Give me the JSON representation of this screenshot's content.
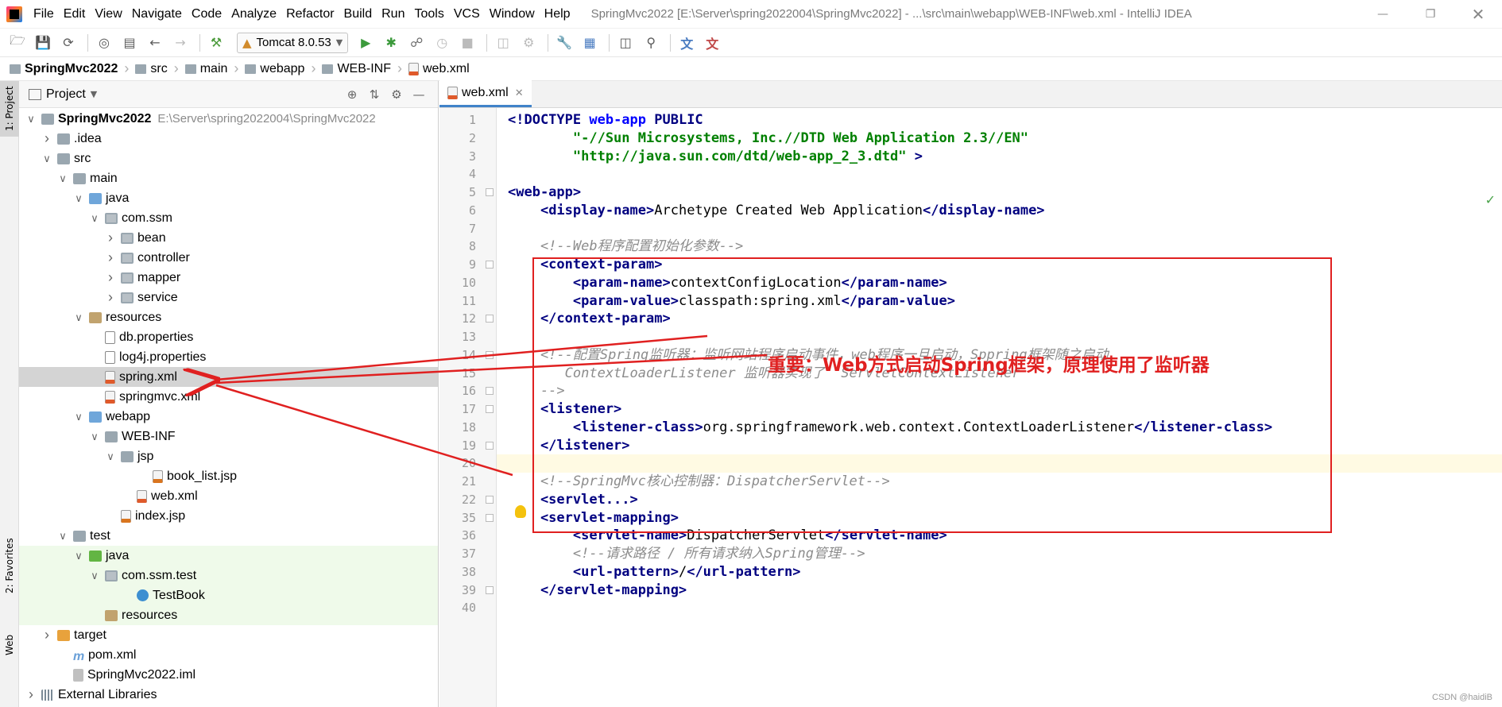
{
  "menubar": {
    "items": [
      "File",
      "Edit",
      "View",
      "Navigate",
      "Code",
      "Analyze",
      "Refactor",
      "Build",
      "Run",
      "Tools",
      "VCS",
      "Window",
      "Help"
    ],
    "title": "SpringMvc2022 [E:\\Server\\spring2022004\\SpringMvc2022] - ...\\src\\main\\webapp\\WEB-INF\\web.xml - IntelliJ IDEA"
  },
  "toolbar": {
    "run_config": "Tomcat 8.0.53"
  },
  "breadcrumb": [
    "SpringMvc2022",
    "src",
    "main",
    "webapp",
    "WEB-INF",
    "web.xml"
  ],
  "left_strip": {
    "project_tab": "1: Project",
    "favorites_tab": "2: Favorites",
    "web_tab": "Web"
  },
  "project_panel": {
    "title": "Project",
    "tree": [
      {
        "label": "SpringMvc2022",
        "hint": "E:\\Server\\spring2022004\\SpringMvc2022",
        "depth": 0,
        "icon": "module",
        "expanded": true,
        "bold": true
      },
      {
        "label": ".idea",
        "depth": 1,
        "icon": "folder",
        "expanded": false
      },
      {
        "label": "src",
        "depth": 1,
        "icon": "folder",
        "expanded": true
      },
      {
        "label": "main",
        "depth": 2,
        "icon": "folder",
        "expanded": true
      },
      {
        "label": "java",
        "depth": 3,
        "icon": "src",
        "expanded": true
      },
      {
        "label": "com.ssm",
        "depth": 4,
        "icon": "pkg",
        "expanded": true
      },
      {
        "label": "bean",
        "depth": 5,
        "icon": "pkg",
        "expanded": false
      },
      {
        "label": "controller",
        "depth": 5,
        "icon": "pkg",
        "expanded": false
      },
      {
        "label": "mapper",
        "depth": 5,
        "icon": "pkg",
        "expanded": false
      },
      {
        "label": "service",
        "depth": 5,
        "icon": "pkg",
        "expanded": false
      },
      {
        "label": "resources",
        "depth": 3,
        "icon": "res",
        "expanded": true
      },
      {
        "label": "db.properties",
        "depth": 4,
        "icon": "file",
        "leaf": true
      },
      {
        "label": "log4j.properties",
        "depth": 4,
        "icon": "file",
        "leaf": true
      },
      {
        "label": "spring.xml",
        "depth": 4,
        "icon": "xml",
        "leaf": true,
        "selected": true
      },
      {
        "label": "springmvc.xml",
        "depth": 4,
        "icon": "xml",
        "leaf": true
      },
      {
        "label": "webapp",
        "depth": 3,
        "icon": "src",
        "expanded": true
      },
      {
        "label": "WEB-INF",
        "depth": 4,
        "icon": "folder",
        "expanded": true
      },
      {
        "label": "jsp",
        "depth": 5,
        "icon": "folder",
        "expanded": true
      },
      {
        "label": "book_list.jsp",
        "depth": 7,
        "icon": "jsp",
        "leaf": true
      },
      {
        "label": "web.xml",
        "depth": 6,
        "icon": "xml",
        "leaf": true
      },
      {
        "label": "index.jsp",
        "depth": 5,
        "icon": "jsp",
        "leaf": true
      },
      {
        "label": "test",
        "depth": 2,
        "icon": "folder",
        "expanded": true
      },
      {
        "label": "java",
        "depth": 3,
        "icon": "test",
        "expanded": true,
        "test": true
      },
      {
        "label": "com.ssm.test",
        "depth": 4,
        "icon": "pkg",
        "expanded": true,
        "test": true
      },
      {
        "label": "TestBook",
        "depth": 6,
        "icon": "cls",
        "leaf": true,
        "test": true
      },
      {
        "label": "resources",
        "depth": 4,
        "icon": "res",
        "leaf": true,
        "test": true
      },
      {
        "label": "target",
        "depth": 1,
        "icon": "target",
        "expanded": false
      },
      {
        "label": "pom.xml",
        "depth": 2,
        "icon": "maven",
        "leaf": true
      },
      {
        "label": "SpringMvc2022.iml",
        "depth": 2,
        "icon": "iml",
        "leaf": true
      },
      {
        "label": "External Libraries",
        "depth": 0,
        "icon": "lib",
        "expanded": false
      }
    ]
  },
  "editor": {
    "tab": "web.xml",
    "current_line": "20",
    "lines": [
      {
        "n": "1",
        "t": "<!DOCTYPE web-app PUBLIC",
        "k": "doctype"
      },
      {
        "n": "2",
        "t": "        \"-//Sun Microsystems, Inc.//DTD Web Application 2.3//EN\"",
        "k": "str"
      },
      {
        "n": "3",
        "t": "        \"http://java.sun.com/dtd/web-app_2_3.dtd\" >",
        "k": "str"
      },
      {
        "n": "4",
        "t": "",
        "k": "txt"
      },
      {
        "n": "5",
        "t": "<web-app>",
        "k": "tag"
      },
      {
        "n": "6",
        "t": "    <display-name>Archetype Created Web Application</display-name>",
        "k": "mixed"
      },
      {
        "n": "7",
        "t": "",
        "k": "txt"
      },
      {
        "n": "8",
        "t": "    <!--Web程序配置初始化参数-->",
        "k": "cmt"
      },
      {
        "n": "9",
        "t": "    <context-param>",
        "k": "tag"
      },
      {
        "n": "10",
        "t": "        <param-name>contextConfigLocation</param-name>",
        "k": "mixed"
      },
      {
        "n": "11",
        "t": "        <param-value>classpath:spring.xml</param-value>",
        "k": "mixed"
      },
      {
        "n": "12",
        "t": "    </context-param>",
        "k": "tag"
      },
      {
        "n": "13",
        "t": "",
        "k": "txt"
      },
      {
        "n": "14",
        "t": "    <!--配置Spring监听器：监听网站程序启动事件，web程序一旦启动，Sppring框架随之启动",
        "k": "cmt"
      },
      {
        "n": "15",
        "t": "       ContextLoaderListener 监听器实现了  ServletContextListener",
        "k": "cmt"
      },
      {
        "n": "16",
        "t": "    -->",
        "k": "cmt"
      },
      {
        "n": "17",
        "t": "    <listener>",
        "k": "tag"
      },
      {
        "n": "18",
        "t": "        <listener-class>org.springframework.web.context.ContextLoaderListener</listener-class>",
        "k": "mixed"
      },
      {
        "n": "19",
        "t": "    </listener>",
        "k": "tag"
      },
      {
        "n": "20",
        "t": "",
        "k": "txt"
      },
      {
        "n": "21",
        "t": "    <!--SpringMvc核心控制器：DispatcherServlet-->",
        "k": "cmt"
      },
      {
        "n": "22",
        "t": "    <servlet...>",
        "k": "tag"
      },
      {
        "n": "35",
        "t": "    <servlet-mapping>",
        "k": "tag"
      },
      {
        "n": "36",
        "t": "        <servlet-name>DispatcherServlet</servlet-name>",
        "k": "mixed"
      },
      {
        "n": "37",
        "t": "        <!--请求路径 / 所有请求纳入Spring管理-->",
        "k": "cmt"
      },
      {
        "n": "38",
        "t": "        <url-pattern>/</url-pattern>",
        "k": "mixed"
      },
      {
        "n": "39",
        "t": "    </servlet-mapping>",
        "k": "tag"
      },
      {
        "n": "40",
        "t": "",
        "k": "txt"
      }
    ]
  },
  "annotation": {
    "note": "重要：Web方式启动Spring框架，原理使用了监听器",
    "color": "#e02020"
  },
  "watermark": "CSDN @haidiB"
}
